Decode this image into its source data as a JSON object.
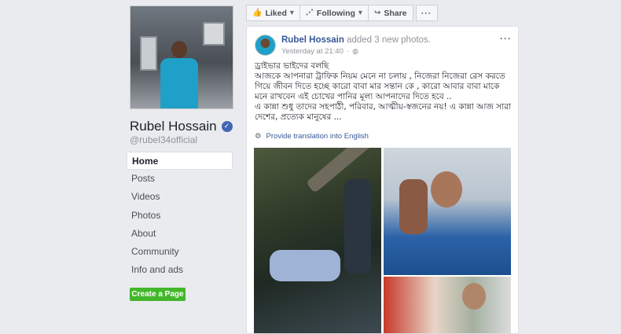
{
  "page": {
    "name": "Rubel Hossain",
    "handle": "@rubel34official",
    "verified_glyph": "✓"
  },
  "nav": {
    "items": [
      {
        "label": "Home",
        "active": true
      },
      {
        "label": "Posts"
      },
      {
        "label": "Videos"
      },
      {
        "label": "Photos"
      },
      {
        "label": "About"
      },
      {
        "label": "Community"
      },
      {
        "label": "Info and ads"
      }
    ],
    "create_page_label": "Create a Page"
  },
  "actions": {
    "liked_label": "Liked",
    "following_label": "Following",
    "share_label": "Share",
    "more_label": "···"
  },
  "post": {
    "author": "Rubel Hossain",
    "action_text": "added 3 new photos.",
    "timestamp": "Yesterday at 21:40",
    "meta_separator": "·",
    "text_lines": [
      "ড্রাইভার ভাইদের বলছি",
      "আজকে আপনারা ট্রাফিক নিয়ম মেনে না চলায় , নিজেরা নিজেরা রেস করতে গিয়ে জীবন দিতে হচ্ছে কারো বাবা মার সন্তান কে , কারো আবার বাবা মাকে মনে রাখবেন এই চোখের পানির মূল্য আপনাদের দিতে হবে ..",
      "এ কান্না শুধু তাদের সহপাঠী, পরিবার, আত্মীয়-স্বজনের নয়! এ কান্না আজ সারা দেশের, প্রত্যেক মানুষের ..."
    ],
    "translate_label": "Provide translation into English"
  },
  "icons": {
    "liked": "like-thumb-icon",
    "following": "rss-icon",
    "share": "share-arrow-icon",
    "globe": "globe-icon",
    "gear": "gear-icon",
    "verified": "verified-check-icon"
  },
  "colors": {
    "link": "#385898",
    "create_button": "#42b72a",
    "verified": "#4267b2",
    "background": "#e9ebee"
  }
}
